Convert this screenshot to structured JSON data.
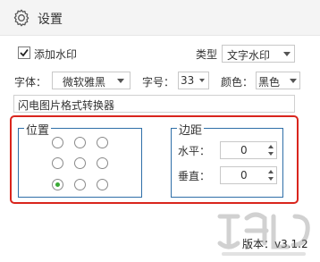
{
  "header": {
    "title": "设置",
    "icon": "gear-icon"
  },
  "watermark_option": {
    "checkbox_label": "添加水印",
    "checked": true,
    "type_label": "类型",
    "type_value": "文字水印"
  },
  "font_row": {
    "font_label": "字体：",
    "font_value": "微软雅黑",
    "size_label": "字号：",
    "size_value": "33",
    "color_label": "颜色：",
    "color_value": "黑色"
  },
  "watermark_text": "闪电图片格式转换器",
  "position": {
    "title": "位置",
    "grid_rows": 3,
    "grid_cols": 3,
    "selected": "bottom-left"
  },
  "margin": {
    "title": "边距",
    "horizontal_label": "水平：",
    "horizontal_value": "0",
    "vertical_label": "垂直：",
    "vertical_value": "0"
  },
  "version": "版本：v3.1.2",
  "colors": {
    "highlight_border": "#d9251d",
    "groupbox_border": "#2f6fa8",
    "radio_selected": "#3aaa35"
  }
}
